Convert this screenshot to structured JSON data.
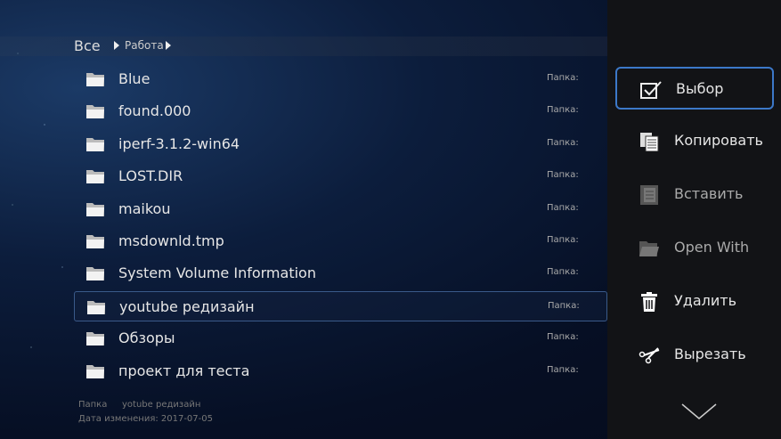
{
  "breadcrumb": {
    "root": "Все",
    "items": [
      "Работа"
    ]
  },
  "files": [
    {
      "name": "Blue",
      "type": "Папка:"
    },
    {
      "name": "found.000",
      "type": "Папка:"
    },
    {
      "name": "iperf-3.1.2-win64",
      "type": "Папка:"
    },
    {
      "name": "LOST.DIR",
      "type": "Папка:"
    },
    {
      "name": "maikou",
      "type": "Папка:"
    },
    {
      "name": "msdownld.tmp",
      "type": "Папка:"
    },
    {
      "name": "System Volume Information",
      "type": "Папка:"
    },
    {
      "name": "youtube редизайн",
      "type": "Папка:",
      "selected": true
    },
    {
      "name": "Обзоры",
      "type": "Папка:"
    },
    {
      "name": "проект для теста",
      "type": "Папка:"
    }
  ],
  "info": {
    "type_label": "Папка",
    "name": "yotube редизайн",
    "date": "Дата изменения: 2017-07-05"
  },
  "menu": [
    {
      "label": "Выбор",
      "icon": "checkbox-icon",
      "selected": true,
      "enabled": true
    },
    {
      "label": "Копировать",
      "icon": "copy-icon",
      "enabled": true
    },
    {
      "label": "Вставить",
      "icon": "paste-icon",
      "enabled": false
    },
    {
      "label": "Open With",
      "icon": "open-folder-icon",
      "enabled": false
    },
    {
      "label": "Удалить",
      "icon": "trash-icon",
      "enabled": true
    },
    {
      "label": "Вырезать",
      "icon": "scissors-icon",
      "enabled": true
    }
  ],
  "colors": {
    "accent": "#3c78c8",
    "panel": "#121316"
  }
}
